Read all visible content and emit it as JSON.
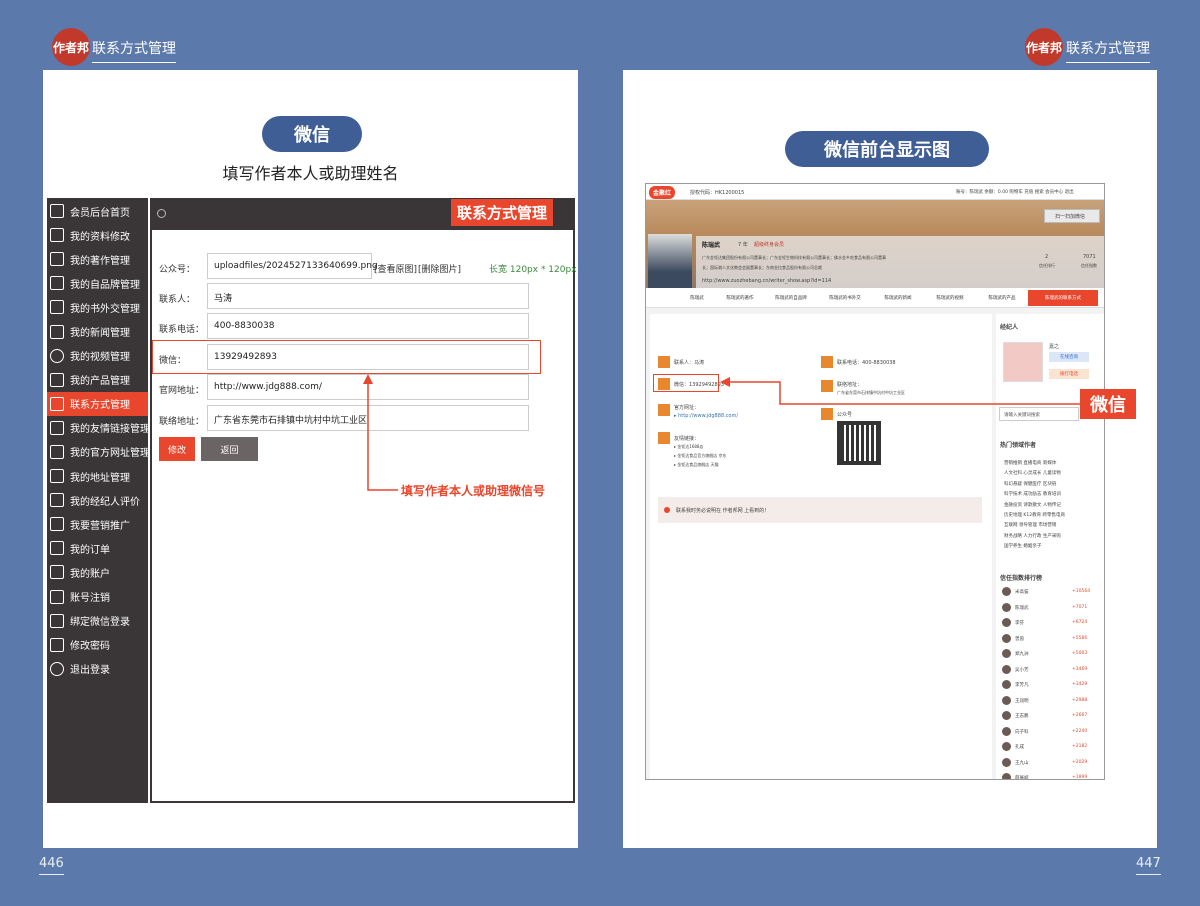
{
  "brand": {
    "logo_text": "作者邦",
    "header_title": "联系方式管理"
  },
  "pages": {
    "left": "446",
    "right": "447"
  },
  "left": {
    "pill": "微信",
    "subtitle": "填写作者本人或助理姓名",
    "section_tag": "联系方式管理",
    "sidebar": [
      {
        "label": "会员后台首页",
        "icon": "home-icon"
      },
      {
        "label": "我的资料修改",
        "icon": "edit-icon"
      },
      {
        "label": "我的著作管理",
        "icon": "book-icon"
      },
      {
        "label": "我的自品牌管理",
        "icon": "camera-icon"
      },
      {
        "label": "我的书外交管理",
        "icon": "handshake-icon"
      },
      {
        "label": "我的新闻管理",
        "icon": "edit-icon"
      },
      {
        "label": "我的视频管理",
        "icon": "play-icon"
      },
      {
        "label": "我的产品管理",
        "icon": "hand-icon"
      },
      {
        "label": "联系方式管理",
        "icon": "phone-icon",
        "active": true
      },
      {
        "label": "我的友情链接管理",
        "icon": "hand-icon"
      },
      {
        "label": "我的官方网址管理",
        "icon": "hand-icon"
      },
      {
        "label": "我的地址管理",
        "icon": "hand-icon"
      },
      {
        "label": "我的经纪人评价",
        "icon": "handshake-icon"
      },
      {
        "label": "我要营销推广",
        "icon": "checkbox-icon"
      },
      {
        "label": "我的订单",
        "icon": "cart-icon"
      },
      {
        "label": "我的账户",
        "icon": "yen-icon"
      },
      {
        "label": "账号注销",
        "icon": "edit-icon"
      },
      {
        "label": "绑定微信登录",
        "icon": "edit-icon"
      },
      {
        "label": "修改密码",
        "icon": "edit-icon"
      },
      {
        "label": "退出登录",
        "icon": "user-icon"
      }
    ],
    "form": {
      "public_account_label": "公众号：",
      "public_account_value": "uploadfiles/2024527133640699.png",
      "view_image": "[查看原图]",
      "delete_image": "[删除图片]",
      "size_hint": "长宽 120px * 120px",
      "contact_label": "联系人：",
      "contact_value": "马涛",
      "phone_label": "联系电话：",
      "phone_value": "400-8830038",
      "wechat_label": "微信：",
      "wechat_value": "13929492893",
      "site_label": "官网地址：",
      "site_value": "http://www.jdg888.com/",
      "address_label": "联络地址：",
      "address_value": "广东省东莞市石排镇中坑村中坑工业区",
      "submit": "修改",
      "back": "返回"
    },
    "annotation": "填写作者本人或助理微信号"
  },
  "right": {
    "pill": "微信前台显示图",
    "callout": "微信",
    "topbar": {
      "site_logo": "金聚红",
      "code": "授权代码：HK1200015",
      "right_links": "账号：陈瑞武  余额：0.00  购物车  充值  搜索  会员中心  退出"
    },
    "profile": {
      "name": "陈瑞武",
      "years": "7 年",
      "badge": "超级终身会员",
      "line1": "广东金钜达集团股份有限公司董事长；广东金钜生物科技有限公司董事长；佛水金乡吃食品有限公司董事",
      "line2": "长；国际湘人文化教会会副董事长；东南金拉食品股份有限公司总裁",
      "url": "http://www.zuozhebang.cn/writer_show.asp?id=114",
      "scan_btn": "扫一扫加微信",
      "stat1_num": "2",
      "stat1_label": "信任排行",
      "stat2_num": "7071",
      "stat2_label": "信任指数"
    },
    "nav": [
      "陈瑞武",
      "陈瑞武的著作",
      "陈瑞武的自品牌",
      "陈瑞武的书外交",
      "陈瑞武的新闻",
      "陈瑞武的视频",
      "陈瑞武的产品",
      "陈瑞武的联系方式"
    ],
    "contact": {
      "person": "联系人：马涛",
      "phone": "联系电话：400-8830038",
      "wechat": "微信：13929492893",
      "address_label": "联络地址：",
      "address": "广东省东莞市石排镇中坑村中坑工业区",
      "site_label": "官方网址：",
      "site": "▸ http://www.jdg888.com/",
      "qr_label": "公众号",
      "links_label": "友情链接：",
      "link1": "▸ 金钜达1688店",
      "link2": "▸ 金钜达食品官方旗舰店 京东",
      "link3": "▸ 金钜达食品旗舰店 天猫",
      "notice": "联系我时务必说明在 作者邦网 上看到的！"
    },
    "agent": {
      "title": "经纪人",
      "name": "嘉之",
      "btn1": "在线咨询",
      "btn2": "拨打电话"
    },
    "search_placeholder": "请输入关键词搜索",
    "hot": {
      "title": "热门领域作者",
      "rows": [
        "营销推销  直播电商  新媒体",
        "人文社科  心灵成长  儿童读物",
        "科幻悬疑  保健医疗  区块链",
        "科学技术  成功励志  教育培训",
        "金融投资  诗歌散文  人物传记",
        "历史地理  K12教育  跨零售电商",
        "互联网  领导管理  市场营销",
        "财务战略  人力行政  生产采购",
        "国学养生  婚姻亲子"
      ]
    },
    "rank": {
      "title": "信任指数排行榜",
      "items": [
        {
          "name": "米高猫",
          "score": "+10564"
        },
        {
          "name": "陈瑞武",
          "score": "+7071"
        },
        {
          "name": "李芬",
          "score": "+6724"
        },
        {
          "name": "曾茵",
          "score": "+5586"
        },
        {
          "name": "郑九洲",
          "score": "+5003"
        },
        {
          "name": "吴小芳",
          "score": "+3469"
        },
        {
          "name": "李芳凡",
          "score": "+3429"
        },
        {
          "name": "王润明",
          "score": "+2988"
        },
        {
          "name": "王志鹏",
          "score": "+2667"
        },
        {
          "name": "向子科",
          "score": "+2240"
        },
        {
          "name": "孔成",
          "score": "+2182"
        },
        {
          "name": "王九山",
          "score": "+2029"
        },
        {
          "name": "薛展斌",
          "score": "+1899"
        }
      ]
    }
  },
  "colors": {
    "accent": "#e8472d",
    "navy": "#3f5e96",
    "bg": "#5c79ab",
    "dark": "#3a3536"
  }
}
